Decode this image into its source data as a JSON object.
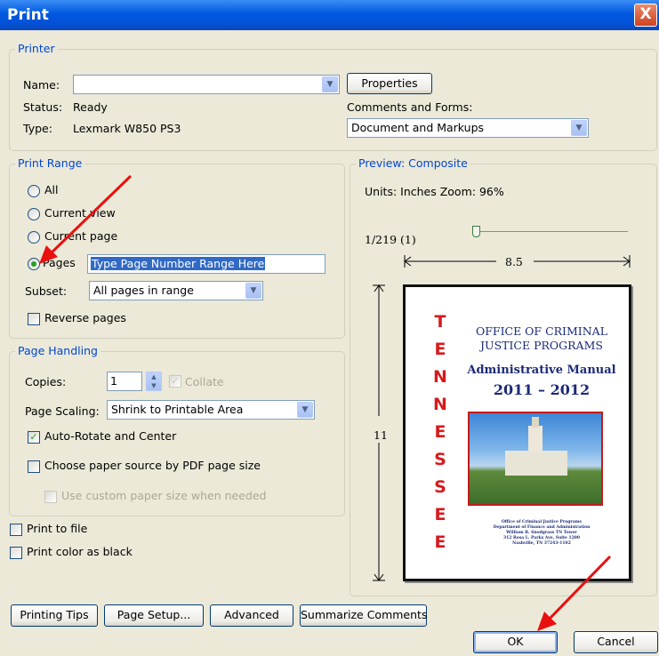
{
  "window": {
    "title": "Print",
    "close_glyph": "X"
  },
  "printer": {
    "legend": "Printer",
    "name_label": "Name:",
    "name_value": "",
    "properties_button": "Properties",
    "status_label": "Status:",
    "status_value": "Ready",
    "type_label": "Type:",
    "type_value": "Lexmark W850 PS3",
    "comments_label": "Comments and Forms:",
    "comments_value": "Document and Markups"
  },
  "print_range": {
    "legend": "Print Range",
    "options": [
      "All",
      "Current view",
      "Current page",
      "Pages"
    ],
    "selected": "Pages",
    "pages_input_value": "Type Page Number Range Here",
    "subset_label": "Subset:",
    "subset_value": "All pages in range",
    "reverse_label": "Reverse pages",
    "reverse_checked": false
  },
  "page_handling": {
    "legend": "Page Handling",
    "copies_label": "Copies:",
    "copies_value": "1",
    "collate_label": "Collate",
    "collate_checked": true,
    "collate_enabled": false,
    "scaling_label": "Page Scaling:",
    "scaling_value": "Shrink to Printable Area",
    "autorotate_label": "Auto-Rotate and Center",
    "autorotate_checked": true,
    "paper_source_label": "Choose paper source by PDF page size",
    "paper_source_checked": false,
    "custom_size_label": "Use custom paper size when needed",
    "custom_size_enabled": false
  },
  "print_to_file_label": "Print to file",
  "print_color_black_label": "Print color as black",
  "preview": {
    "legend": "Preview: Composite",
    "units_zoom": "Units: Inches Zoom:  96%",
    "page_counter": "1/219 (1)",
    "page_slider_fraction": 0.0,
    "width_value": "8.5",
    "height_value": "11",
    "page": {
      "vertical_word_letters": [
        "T",
        "E",
        "N",
        "N",
        "E",
        "S",
        "S",
        "E",
        "E"
      ],
      "office_line1": "OFFICE OF CRIMINAL",
      "office_line2": "JUSTICE PROGRAMS",
      "manual_title": "Administrative Manual",
      "years": "2011 – 2012",
      "address_lines": [
        "Office of Criminal Justice Programs",
        "Department of Finance and Administration",
        "William R. Snodgrass TN Tower",
        "312 Rosa L. Parks Ave, Suite 1200",
        "Nashville, TN 37243-1102"
      ]
    }
  },
  "buttons": {
    "printing_tips": "Printing Tips",
    "page_setup": "Page Setup...",
    "advanced": "Advanced",
    "summarize": "Summarize Comments",
    "ok": "OK",
    "cancel": "Cancel"
  },
  "colors": {
    "title_bar": "#0058e0",
    "legend_text": "#0046d5",
    "annotation_arrow": "#e8110f",
    "selection": "#316ac5",
    "vertical_word": "#d7191c",
    "page_heading": "#1b2a78"
  }
}
